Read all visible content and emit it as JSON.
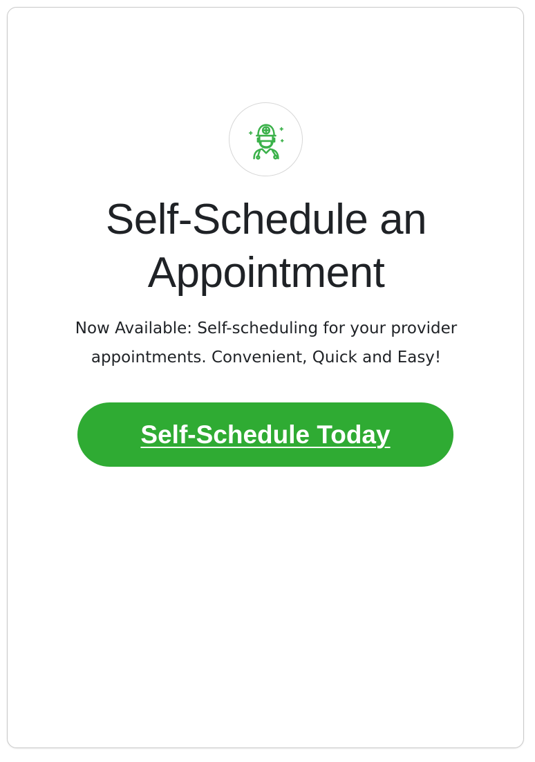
{
  "card": {
    "icon": "doctor-icon",
    "title": "Self-Schedule an Appointment",
    "description": "Now Available: Self-scheduling for your provider appointments. Convenient, Quick and Easy!",
    "button_label": "Self-Schedule Today"
  },
  "colors": {
    "accent": "#2fab33",
    "icon_green": "#3bb14a",
    "text": "#1f2226",
    "border": "#c9c9c9",
    "background": "#ffffff"
  }
}
